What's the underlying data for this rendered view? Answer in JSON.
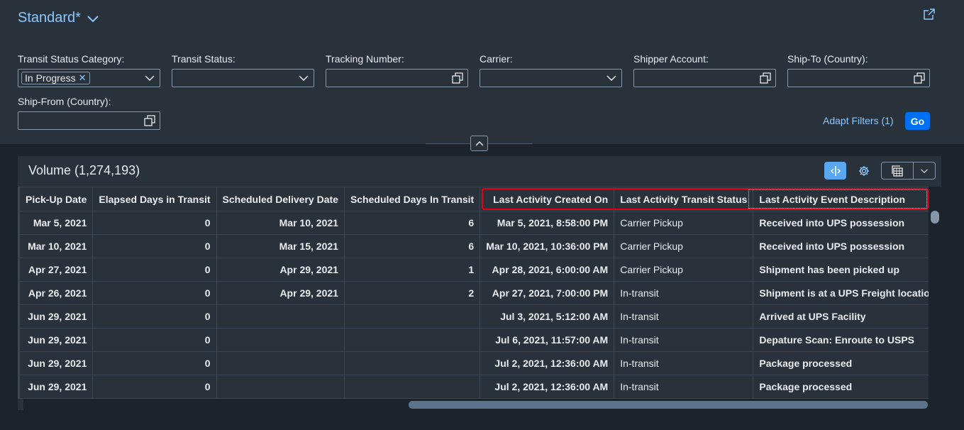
{
  "variant": {
    "title": "Standard*"
  },
  "filters": [
    {
      "label": "Transit Status Category:",
      "token": "In Progress",
      "icon": "chevron-down-icon"
    },
    {
      "label": "Transit Status:",
      "icon": "chevron-down-icon"
    },
    {
      "label": "Tracking Number:",
      "icon": "value-help-icon"
    },
    {
      "label": "Carrier:",
      "icon": "chevron-down-icon"
    },
    {
      "label": "Shipper Account:",
      "icon": "value-help-icon"
    },
    {
      "label": "Ship-To (Country):",
      "icon": "value-help-icon"
    },
    {
      "label": "Ship-From (Country):",
      "icon": "value-help-icon"
    }
  ],
  "actions": {
    "adapt_filters": "Adapt Filters (1)",
    "go": "Go"
  },
  "table": {
    "title": "Volume (1,274,193)",
    "columns": [
      "Pick-Up Date",
      "Elapsed Days in Transit",
      "Scheduled Delivery Date",
      "Scheduled Days In Transit",
      "Last Activity Created On",
      "Last Activity Transit Status",
      "Last Activity Event Description"
    ],
    "rows": [
      [
        "Mar 5, 2021",
        "0",
        "Mar 10, 2021",
        "6",
        "Mar 5, 2021, 8:58:00 PM",
        "Carrier Pickup",
        "Received into UPS possession"
      ],
      [
        "Mar 10, 2021",
        "0",
        "Mar 15, 2021",
        "6",
        "Mar 10, 2021, 10:36:00 PM",
        "Carrier Pickup",
        "Received into UPS possession"
      ],
      [
        "Apr 27, 2021",
        "0",
        "Apr 29, 2021",
        "1",
        "Apr 28, 2021, 6:00:00 AM",
        "Carrier Pickup",
        "Shipment has been picked up"
      ],
      [
        "Apr 26, 2021",
        "0",
        "Apr 29, 2021",
        "2",
        "Apr 27, 2021, 7:00:00 PM",
        "In-transit",
        "Shipment is at a UPS Freight location"
      ],
      [
        "Jun 29, 2021",
        "0",
        "",
        "",
        "Jul 3, 2021, 5:12:00 AM",
        "In-transit",
        "Arrived at UPS Facility"
      ],
      [
        "Jun 29, 2021",
        "0",
        "",
        "",
        "Jul 6, 2021, 11:57:00 AM",
        "In-transit",
        "Depature Scan: Enroute to USPS"
      ],
      [
        "Jun 29, 2021",
        "0",
        "",
        "",
        "Jul 2, 2021, 12:36:00 AM",
        "In-transit",
        "Package processed"
      ],
      [
        "Jun 29, 2021",
        "0",
        "",
        "",
        "Jul 2, 2021, 12:36:00 AM",
        "In-transit",
        "Package processed"
      ]
    ]
  },
  "colors": {
    "accent": "#0070f2",
    "link": "#8cc8ff",
    "highlight": "#e3001b",
    "shell_bg": "#29313a",
    "page_bg": "#1d232a"
  }
}
